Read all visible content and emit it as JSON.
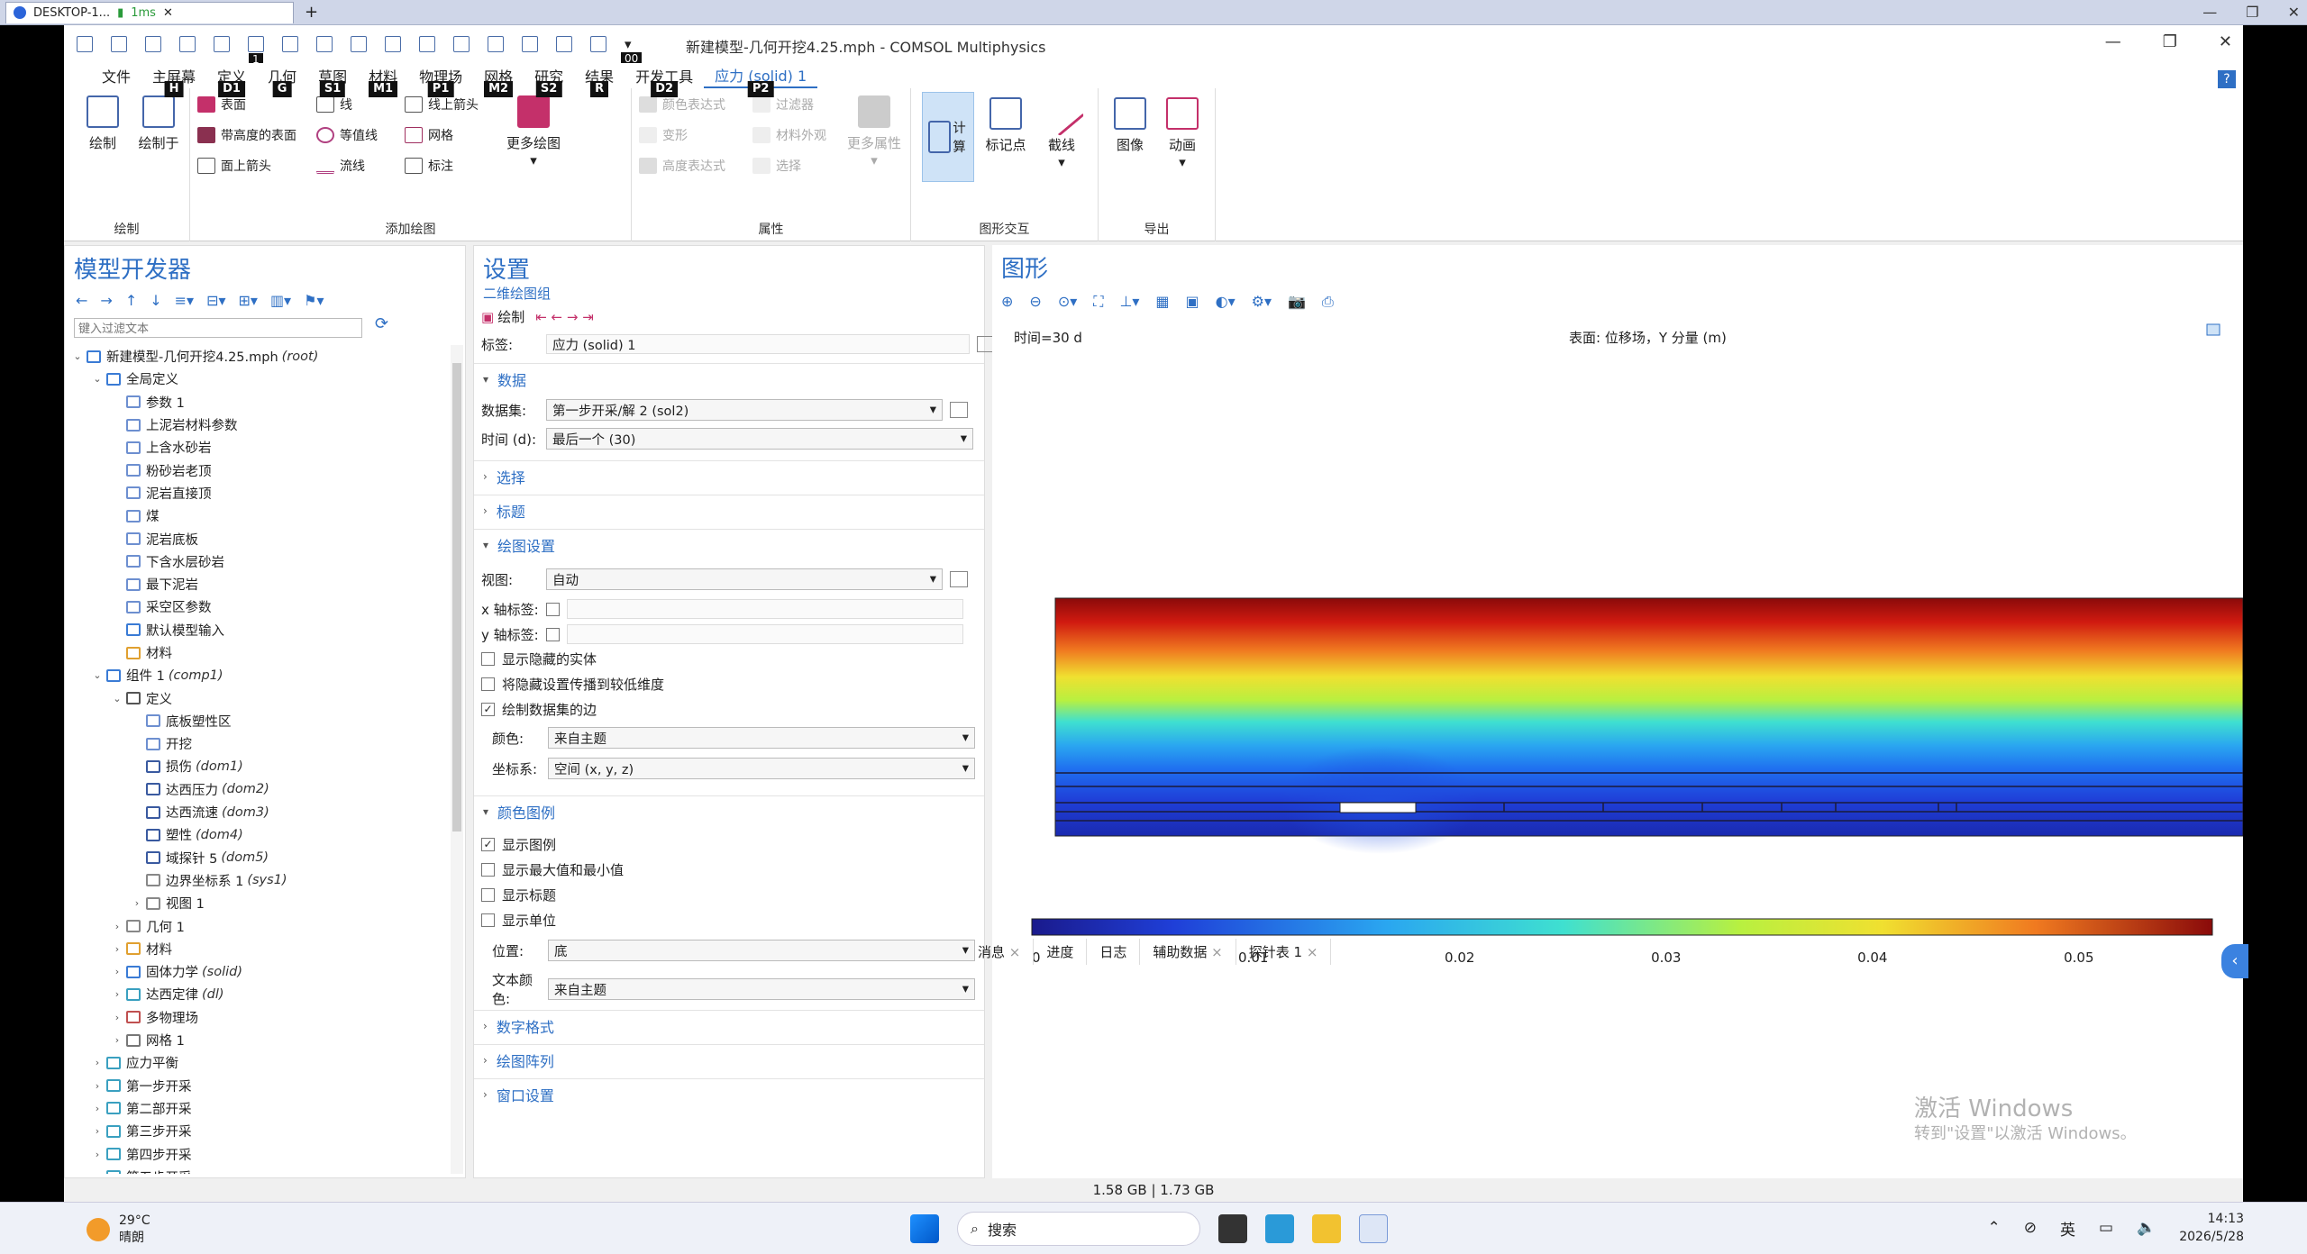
{
  "rdp": {
    "tab": "DESKTOP-1...",
    "ping": "1ms"
  },
  "window": {
    "title": "新建模型-几何开挖4.25.mph - COMSOL Multiphysics",
    "help": "?"
  },
  "menu": [
    {
      "label": "文件",
      "key": ""
    },
    {
      "label": "主屏幕",
      "key": "H"
    },
    {
      "label": "定义",
      "key": "D1"
    },
    {
      "label": "几何",
      "key": "G"
    },
    {
      "label": "草图",
      "key": "S1"
    },
    {
      "label": "材料",
      "key": "M1"
    },
    {
      "label": "物理场",
      "key": "P1"
    },
    {
      "label": "网格",
      "key": "M2"
    },
    {
      "label": "研究",
      "key": "S2"
    },
    {
      "label": "结果",
      "key": "R"
    },
    {
      "label": "开发工具",
      "key": "D2"
    },
    {
      "label": "应力 (solid) 1",
      "key": "P2"
    }
  ],
  "qa_badge": "1",
  "qa_badge2": "00",
  "ribbon": {
    "draw": "绘制",
    "draw_in": "绘制于",
    "group_draw": "绘制",
    "surface": "表面",
    "height_surface": "带高度的表面",
    "surface_arrow": "面上箭头",
    "line": "线",
    "contour": "等值线",
    "streamline": "流线",
    "line_arrow": "线上箭头",
    "mesh": "网格",
    "annotation": "标注",
    "more_plots": "更多绘图",
    "group_add": "添加绘图",
    "color_expr": "颜色表达式",
    "deform": "变形",
    "height_expr": "高度表达式",
    "filter": "过滤器",
    "material_appearance": "材料外观",
    "selection": "选择",
    "more_attr": "更多属性",
    "group_attr": "属性",
    "compute": "计算",
    "marker": "标记点",
    "cutline": "截线",
    "group_interact": "图形交互",
    "image": "图像",
    "animation": "动画",
    "group_export": "导出"
  },
  "model_builder": {
    "title": "模型开发器",
    "filter_placeholder": "键入过滤文本",
    "tree": [
      {
        "d": 0,
        "t": "v",
        "label": "新建模型-几何开挖4.25.mph",
        "it": "(root)",
        "c": "#3a7bd5"
      },
      {
        "d": 1,
        "t": "v",
        "label": "全局定义",
        "it": "",
        "c": "#3a7bd5"
      },
      {
        "d": 2,
        "t": "",
        "label": "参数 1",
        "it": "",
        "c": "#6d8fd0"
      },
      {
        "d": 2,
        "t": "",
        "label": "上泥岩材料参数",
        "it": "",
        "c": "#6d8fd0"
      },
      {
        "d": 2,
        "t": "",
        "label": "上含水砂岩",
        "it": "",
        "c": "#6d8fd0"
      },
      {
        "d": 2,
        "t": "",
        "label": "粉砂岩老顶",
        "it": "",
        "c": "#6d8fd0"
      },
      {
        "d": 2,
        "t": "",
        "label": "泥岩直接顶",
        "it": "",
        "c": "#6d8fd0"
      },
      {
        "d": 2,
        "t": "",
        "label": "煤",
        "it": "",
        "c": "#6d8fd0"
      },
      {
        "d": 2,
        "t": "",
        "label": "泥岩底板",
        "it": "",
        "c": "#6d8fd0"
      },
      {
        "d": 2,
        "t": "",
        "label": "下含水层砂岩",
        "it": "",
        "c": "#6d8fd0"
      },
      {
        "d": 2,
        "t": "",
        "label": "最下泥岩",
        "it": "",
        "c": "#6d8fd0"
      },
      {
        "d": 2,
        "t": "",
        "label": "采空区参数",
        "it": "",
        "c": "#6d8fd0"
      },
      {
        "d": 2,
        "t": "",
        "label": "默认模型输入",
        "it": "",
        "c": "#3a7bd5"
      },
      {
        "d": 2,
        "t": "",
        "label": "材料",
        "it": "",
        "c": "#e0a030"
      },
      {
        "d": 1,
        "t": "v",
        "label": "组件 1",
        "it": "(comp1)",
        "c": "#3a7bd5"
      },
      {
        "d": 2,
        "t": "v",
        "label": "定义",
        "it": "",
        "c": "#555"
      },
      {
        "d": 3,
        "t": "",
        "label": "底板塑性区",
        "it": "",
        "c": "#6d8fd0"
      },
      {
        "d": 3,
        "t": "",
        "label": "开挖",
        "it": "",
        "c": "#6d8fd0"
      },
      {
        "d": 3,
        "t": "",
        "label": "损伤",
        "it": "(dom1)",
        "c": "#3a5aa0"
      },
      {
        "d": 3,
        "t": "",
        "label": "达西压力",
        "it": "(dom2)",
        "c": "#3a5aa0"
      },
      {
        "d": 3,
        "t": "",
        "label": "达西流速",
        "it": "(dom3)",
        "c": "#3a5aa0"
      },
      {
        "d": 3,
        "t": "",
        "label": "塑性",
        "it": "(dom4)",
        "c": "#3a5aa0"
      },
      {
        "d": 3,
        "t": "",
        "label": "域探针 5",
        "it": "(dom5)",
        "c": "#3a5aa0"
      },
      {
        "d": 3,
        "t": "",
        "label": "边界坐标系 1",
        "it": "(sys1)",
        "c": "#888"
      },
      {
        "d": 3,
        "t": ">",
        "label": "视图 1",
        "it": "",
        "c": "#888"
      },
      {
        "d": 2,
        "t": ">",
        "label": "几何 1",
        "it": "",
        "c": "#888"
      },
      {
        "d": 2,
        "t": ">",
        "label": "材料",
        "it": "",
        "c": "#e0a030"
      },
      {
        "d": 2,
        "t": ">",
        "label": "固体力学",
        "it": "(solid)",
        "c": "#3a7bd5"
      },
      {
        "d": 2,
        "t": ">",
        "label": "达西定律",
        "it": "(dl)",
        "c": "#3aa0c0"
      },
      {
        "d": 2,
        "t": ">",
        "label": "多物理场",
        "it": "",
        "c": "#c05050"
      },
      {
        "d": 2,
        "t": ">",
        "label": "网格 1",
        "it": "",
        "c": "#777"
      },
      {
        "d": 1,
        "t": ">",
        "label": "应力平衡",
        "it": "",
        "c": "#3aa0c0"
      },
      {
        "d": 1,
        "t": ">",
        "label": "第一步开采",
        "it": "",
        "c": "#3aa0c0"
      },
      {
        "d": 1,
        "t": ">",
        "label": "第二部开采",
        "it": "",
        "c": "#3aa0c0"
      },
      {
        "d": 1,
        "t": ">",
        "label": "第三步开采",
        "it": "",
        "c": "#3aa0c0"
      },
      {
        "d": 1,
        "t": ">",
        "label": "第四步开采",
        "it": "",
        "c": "#3aa0c0"
      },
      {
        "d": 1,
        "t": ">",
        "label": "第五步开采",
        "it": "",
        "c": "#3aa0c0"
      }
    ]
  },
  "settings": {
    "title": "设置",
    "subtitle": "二维绘图组",
    "draw": "绘制",
    "label_label": "标签:",
    "label_value": "应力 (solid) 1",
    "sec_data": "数据",
    "dataset_label": "数据集:",
    "dataset_value": "第一步开采/解 2 (sol2)",
    "time_label": "时间 (d):",
    "time_value": "最后一个 (30)",
    "sec_selection": "选择",
    "sec_title": "标题",
    "sec_plot": "绘图设置",
    "view_label": "视图:",
    "view_value": "自动",
    "xlabel": "x 轴标签:",
    "ylabel": "y 轴标签:",
    "show_hidden": "显示隐藏的实体",
    "propagate": "将隐藏设置传播到较低维度",
    "draw_edges": "绘制数据集的边",
    "color_label": "颜色:",
    "color_value": "来自主题",
    "coord_label": "坐标系:",
    "coord_value": "空间 (x, y, z)",
    "sec_legend": "颜色图例",
    "show_legend": "显示图例",
    "show_minmax": "显示最大值和最小值",
    "show_title": "显示标题",
    "show_unit": "显示单位",
    "pos_label": "位置:",
    "pos_value": "底",
    "textcolor_label": "文本颜色:",
    "textcolor_value": "来自主题",
    "sec_number": "数字格式",
    "sec_array": "绘图阵列",
    "sec_window": "窗口设置"
  },
  "graphics": {
    "title": "图形",
    "time_text": "时间=30 d",
    "plot_title": "表面: 位移场，Y 分量 (m)",
    "legend_ticks": [
      "0",
      "0.01",
      "0.02",
      "0.03",
      "0.04",
      "0.05"
    ]
  },
  "bottom_tabs": [
    "消息",
    "进度",
    "日志",
    "辅助数据",
    "探针表 1"
  ],
  "status": "1.58 GB | 1.73 GB",
  "watermark": {
    "l1": "激活 Windows",
    "l2": "转到\"设置\"以激活 Windows。"
  },
  "taskbar": {
    "temp": "29°C",
    "weather": "晴朗",
    "search": "搜索",
    "ime": "英",
    "time": "14:13",
    "date": "2026/5/28"
  }
}
